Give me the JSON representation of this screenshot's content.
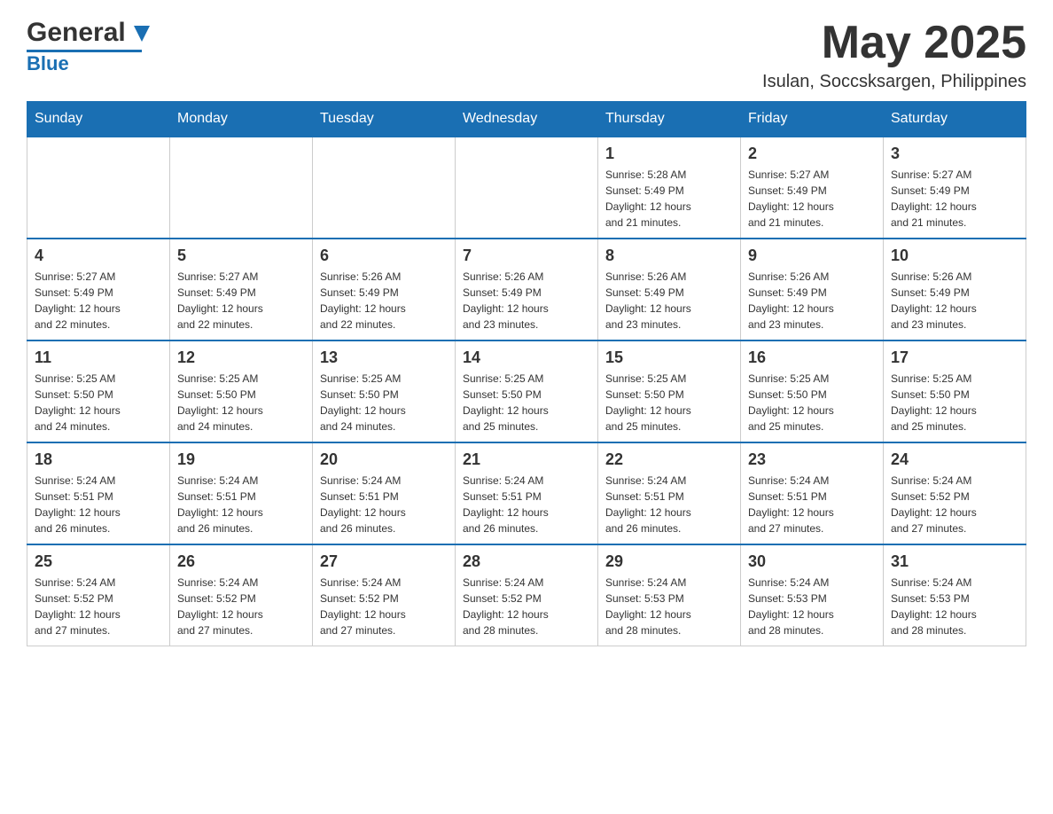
{
  "header": {
    "logo_general": "General",
    "logo_blue": "Blue",
    "month_title": "May 2025",
    "location": "Isulan, Soccsksargen, Philippines"
  },
  "weekdays": [
    "Sunday",
    "Monday",
    "Tuesday",
    "Wednesday",
    "Thursday",
    "Friday",
    "Saturday"
  ],
  "weeks": [
    [
      {
        "day": "",
        "info": ""
      },
      {
        "day": "",
        "info": ""
      },
      {
        "day": "",
        "info": ""
      },
      {
        "day": "",
        "info": ""
      },
      {
        "day": "1",
        "info": "Sunrise: 5:28 AM\nSunset: 5:49 PM\nDaylight: 12 hours\nand 21 minutes."
      },
      {
        "day": "2",
        "info": "Sunrise: 5:27 AM\nSunset: 5:49 PM\nDaylight: 12 hours\nand 21 minutes."
      },
      {
        "day": "3",
        "info": "Sunrise: 5:27 AM\nSunset: 5:49 PM\nDaylight: 12 hours\nand 21 minutes."
      }
    ],
    [
      {
        "day": "4",
        "info": "Sunrise: 5:27 AM\nSunset: 5:49 PM\nDaylight: 12 hours\nand 22 minutes."
      },
      {
        "day": "5",
        "info": "Sunrise: 5:27 AM\nSunset: 5:49 PM\nDaylight: 12 hours\nand 22 minutes."
      },
      {
        "day": "6",
        "info": "Sunrise: 5:26 AM\nSunset: 5:49 PM\nDaylight: 12 hours\nand 22 minutes."
      },
      {
        "day": "7",
        "info": "Sunrise: 5:26 AM\nSunset: 5:49 PM\nDaylight: 12 hours\nand 23 minutes."
      },
      {
        "day": "8",
        "info": "Sunrise: 5:26 AM\nSunset: 5:49 PM\nDaylight: 12 hours\nand 23 minutes."
      },
      {
        "day": "9",
        "info": "Sunrise: 5:26 AM\nSunset: 5:49 PM\nDaylight: 12 hours\nand 23 minutes."
      },
      {
        "day": "10",
        "info": "Sunrise: 5:26 AM\nSunset: 5:49 PM\nDaylight: 12 hours\nand 23 minutes."
      }
    ],
    [
      {
        "day": "11",
        "info": "Sunrise: 5:25 AM\nSunset: 5:50 PM\nDaylight: 12 hours\nand 24 minutes."
      },
      {
        "day": "12",
        "info": "Sunrise: 5:25 AM\nSunset: 5:50 PM\nDaylight: 12 hours\nand 24 minutes."
      },
      {
        "day": "13",
        "info": "Sunrise: 5:25 AM\nSunset: 5:50 PM\nDaylight: 12 hours\nand 24 minutes."
      },
      {
        "day": "14",
        "info": "Sunrise: 5:25 AM\nSunset: 5:50 PM\nDaylight: 12 hours\nand 25 minutes."
      },
      {
        "day": "15",
        "info": "Sunrise: 5:25 AM\nSunset: 5:50 PM\nDaylight: 12 hours\nand 25 minutes."
      },
      {
        "day": "16",
        "info": "Sunrise: 5:25 AM\nSunset: 5:50 PM\nDaylight: 12 hours\nand 25 minutes."
      },
      {
        "day": "17",
        "info": "Sunrise: 5:25 AM\nSunset: 5:50 PM\nDaylight: 12 hours\nand 25 minutes."
      }
    ],
    [
      {
        "day": "18",
        "info": "Sunrise: 5:24 AM\nSunset: 5:51 PM\nDaylight: 12 hours\nand 26 minutes."
      },
      {
        "day": "19",
        "info": "Sunrise: 5:24 AM\nSunset: 5:51 PM\nDaylight: 12 hours\nand 26 minutes."
      },
      {
        "day": "20",
        "info": "Sunrise: 5:24 AM\nSunset: 5:51 PM\nDaylight: 12 hours\nand 26 minutes."
      },
      {
        "day": "21",
        "info": "Sunrise: 5:24 AM\nSunset: 5:51 PM\nDaylight: 12 hours\nand 26 minutes."
      },
      {
        "day": "22",
        "info": "Sunrise: 5:24 AM\nSunset: 5:51 PM\nDaylight: 12 hours\nand 26 minutes."
      },
      {
        "day": "23",
        "info": "Sunrise: 5:24 AM\nSunset: 5:51 PM\nDaylight: 12 hours\nand 27 minutes."
      },
      {
        "day": "24",
        "info": "Sunrise: 5:24 AM\nSunset: 5:52 PM\nDaylight: 12 hours\nand 27 minutes."
      }
    ],
    [
      {
        "day": "25",
        "info": "Sunrise: 5:24 AM\nSunset: 5:52 PM\nDaylight: 12 hours\nand 27 minutes."
      },
      {
        "day": "26",
        "info": "Sunrise: 5:24 AM\nSunset: 5:52 PM\nDaylight: 12 hours\nand 27 minutes."
      },
      {
        "day": "27",
        "info": "Sunrise: 5:24 AM\nSunset: 5:52 PM\nDaylight: 12 hours\nand 27 minutes."
      },
      {
        "day": "28",
        "info": "Sunrise: 5:24 AM\nSunset: 5:52 PM\nDaylight: 12 hours\nand 28 minutes."
      },
      {
        "day": "29",
        "info": "Sunrise: 5:24 AM\nSunset: 5:53 PM\nDaylight: 12 hours\nand 28 minutes."
      },
      {
        "day": "30",
        "info": "Sunrise: 5:24 AM\nSunset: 5:53 PM\nDaylight: 12 hours\nand 28 minutes."
      },
      {
        "day": "31",
        "info": "Sunrise: 5:24 AM\nSunset: 5:53 PM\nDaylight: 12 hours\nand 28 minutes."
      }
    ]
  ]
}
